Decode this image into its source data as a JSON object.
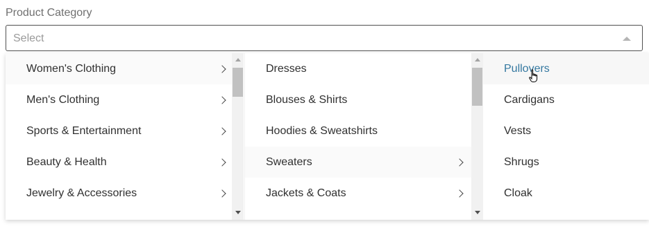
{
  "field": {
    "label": "Product Category",
    "placeholder": "Select"
  },
  "level1": {
    "items": [
      {
        "label": "Women's Clothing",
        "has_children": true
      },
      {
        "label": "Men's Clothing",
        "has_children": true
      },
      {
        "label": "Sports & Entertainment",
        "has_children": true
      },
      {
        "label": "Beauty & Health",
        "has_children": true
      },
      {
        "label": "Jewelry & Accessories",
        "has_children": true
      }
    ]
  },
  "level2": {
    "items": [
      {
        "label": "Dresses",
        "has_children": false
      },
      {
        "label": "Blouses & Shirts",
        "has_children": false
      },
      {
        "label": "Hoodies & Sweatshirts",
        "has_children": false
      },
      {
        "label": "Sweaters",
        "has_children": true
      },
      {
        "label": "Jackets & Coats",
        "has_children": true
      }
    ]
  },
  "level3": {
    "items": [
      {
        "label": "Pullovers"
      },
      {
        "label": "Cardigans"
      },
      {
        "label": "Vests"
      },
      {
        "label": "Shrugs"
      },
      {
        "label": "Cloak"
      }
    ]
  },
  "colors": {
    "hover_text": "#3478a0",
    "text": "#303030",
    "placeholder": "#9a9a9a"
  }
}
